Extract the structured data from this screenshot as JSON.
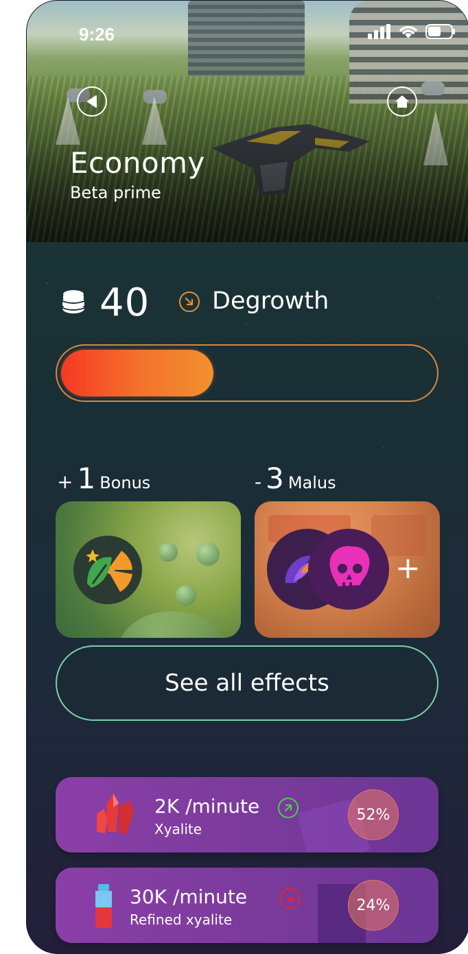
{
  "status_bar": {
    "time": "9:26"
  },
  "header": {
    "title": "Economy",
    "subtitle": "Beta prime"
  },
  "summary": {
    "value": "40",
    "trend": "Degrowth",
    "progress_percent": 41
  },
  "effects": {
    "bonus": {
      "sign": "+",
      "count": "1",
      "label": "Bonus"
    },
    "malus": {
      "sign": "-",
      "count": "3",
      "label": "Malus",
      "more": "+"
    },
    "see_all_label": "See all effects"
  },
  "resources": [
    {
      "rate": "2K /minute",
      "name": "Xyalite",
      "trend": "up",
      "percent": "52%"
    },
    {
      "rate": "30K /minute",
      "name": "Refined xyalite",
      "trend": "down",
      "percent": "24%"
    }
  ],
  "colors": {
    "degrowth": "#f08c2a",
    "up": "#4ccd4c",
    "down": "#e5242c",
    "accent_border": "#79d3a8",
    "bar_from": "#f43a24",
    "bar_to": "#f2902e"
  }
}
